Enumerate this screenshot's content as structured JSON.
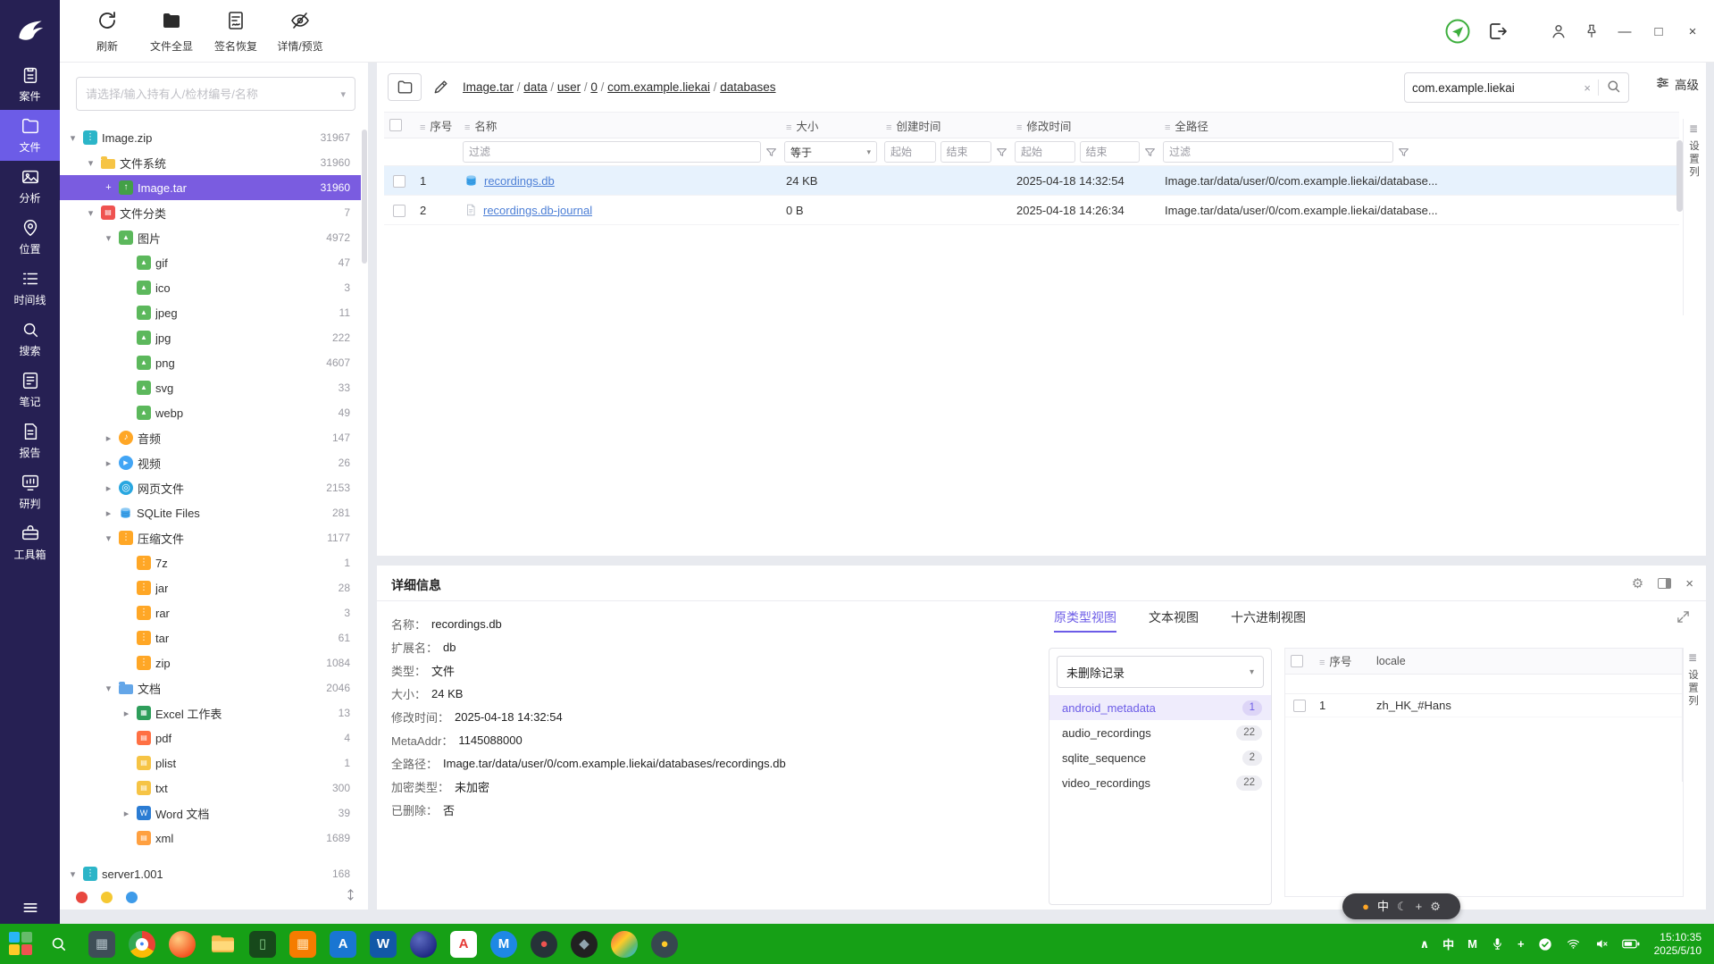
{
  "icons": {
    "minimize": "—",
    "maximize": "□",
    "close": "×",
    "clear": "×",
    "caret_down": "▾",
    "gear": "⚙",
    "menu": "≣"
  },
  "toolbar": {
    "buttons": [
      {
        "name": "refresh",
        "label": "刷新"
      },
      {
        "name": "show-all-files",
        "label": "文件全显"
      },
      {
        "name": "signature-recovery",
        "label": "签名恢复"
      },
      {
        "name": "detail-preview",
        "label": "详情/预览"
      }
    ]
  },
  "sidebar": {
    "items": [
      {
        "name": "case",
        "label": "案件",
        "active": false
      },
      {
        "name": "files",
        "label": "文件",
        "active": true
      },
      {
        "name": "analysis",
        "label": "分析",
        "active": false
      },
      {
        "name": "location",
        "label": "位置",
        "active": false
      },
      {
        "name": "timeline",
        "label": "时间线",
        "active": false
      },
      {
        "name": "search",
        "label": "搜索",
        "active": false
      },
      {
        "name": "notes",
        "label": "笔记",
        "active": false
      },
      {
        "name": "report",
        "label": "报告",
        "active": false
      },
      {
        "name": "judgement",
        "label": "研判",
        "active": false
      },
      {
        "name": "toolbox",
        "label": "工具箱",
        "active": false
      }
    ]
  },
  "tree": {
    "search_placeholder": "请选择/输入持有人/检材编号/名称",
    "nodes": [
      {
        "label": "Image.zip",
        "count": "31967",
        "level": 0,
        "icon": "zip-blue",
        "arrow": "down"
      },
      {
        "label": "文件系统",
        "count": "31960",
        "level": 1,
        "icon": "folder-yellow",
        "arrow": "down"
      },
      {
        "label": "Image.tar",
        "count": "31960",
        "level": 2,
        "icon": "tar-green",
        "arrow": "plus",
        "selected": true
      },
      {
        "label": "文件分类",
        "count": "7",
        "level": 1,
        "icon": "page-red",
        "arrow": "down"
      },
      {
        "label": "图片",
        "count": "4972",
        "level": 2,
        "icon": "image-green",
        "arrow": "down"
      },
      {
        "label": "gif",
        "count": "47",
        "level": 3,
        "icon": "image-green",
        "arrow": "none"
      },
      {
        "label": "ico",
        "count": "3",
        "level": 3,
        "icon": "image-green",
        "arrow": "none"
      },
      {
        "label": "jpeg",
        "count": "11",
        "level": 3,
        "icon": "image-green",
        "arrow": "none"
      },
      {
        "label": "jpg",
        "count": "222",
        "level": 3,
        "icon": "image-green",
        "arrow": "none"
      },
      {
        "label": "png",
        "count": "4607",
        "level": 3,
        "icon": "image-green",
        "arrow": "none"
      },
      {
        "label": "svg",
        "count": "33",
        "level": 3,
        "icon": "image-green",
        "arrow": "none"
      },
      {
        "label": "webp",
        "count": "49",
        "level": 3,
        "icon": "image-green",
        "arrow": "none"
      },
      {
        "label": "音频",
        "count": "147",
        "level": 2,
        "icon": "audio-orange",
        "arrow": "right"
      },
      {
        "label": "视频",
        "count": "26",
        "level": 2,
        "icon": "video-blue",
        "arrow": "right"
      },
      {
        "label": "网页文件",
        "count": "2153",
        "level": 2,
        "icon": "web-blue",
        "arrow": "right"
      },
      {
        "label": "SQLite Files",
        "count": "281",
        "level": 2,
        "icon": "db-blue",
        "arrow": "right"
      },
      {
        "label": "压缩文件",
        "count": "1177",
        "level": 2,
        "icon": "archive-orange",
        "arrow": "down"
      },
      {
        "label": "7z",
        "count": "1",
        "level": 3,
        "icon": "archive-orange",
        "arrow": "none"
      },
      {
        "label": "jar",
        "count": "28",
        "level": 3,
        "icon": "archive-orange",
        "arrow": "none"
      },
      {
        "label": "rar",
        "count": "3",
        "level": 3,
        "icon": "archive-orange",
        "arrow": "none"
      },
      {
        "label": "tar",
        "count": "61",
        "level": 3,
        "icon": "archive-orange",
        "arrow": "none"
      },
      {
        "label": "zip",
        "count": "1084",
        "level": 3,
        "icon": "archive-orange",
        "arrow": "none"
      },
      {
        "label": "文档",
        "count": "2046",
        "level": 2,
        "icon": "folder-blue",
        "arrow": "down"
      },
      {
        "label": "Excel 工作表",
        "count": "13",
        "level": 3,
        "icon": "excel-green",
        "arrow": "right"
      },
      {
        "label": "pdf",
        "count": "4",
        "level": 3,
        "icon": "pdf-orange",
        "arrow": "none"
      },
      {
        "label": "plist",
        "count": "1",
        "level": 3,
        "icon": "page-yellow",
        "arrow": "none"
      },
      {
        "label": "txt",
        "count": "300",
        "level": 3,
        "icon": "page-yellow",
        "arrow": "none"
      },
      {
        "label": "Word 文档",
        "count": "39",
        "level": 3,
        "icon": "word-blue",
        "arrow": "right"
      },
      {
        "label": "xml",
        "count": "1689",
        "level": 3,
        "icon": "page-orange",
        "arrow": "none"
      },
      {
        "label": "server1.001",
        "count": "168",
        "level": 0,
        "icon": "zip-blue",
        "arrow": "down",
        "spacer_before": true
      }
    ],
    "tag_dots": [
      "#e8473f",
      "#f5c832",
      "#3e9be9"
    ]
  },
  "breadcrumb": {
    "segments": [
      "Image.tar",
      "data",
      "user",
      "0",
      "com.example.liekai",
      "databases"
    ]
  },
  "search": {
    "value": "com.example.liekai",
    "advanced_label": "高级"
  },
  "file_table": {
    "columns": [
      "序号",
      "名称",
      "大小",
      "创建时间",
      "修改时间",
      "全路径"
    ],
    "filters": {
      "name_placeholder": "过滤",
      "size_operator": "等于",
      "created_start": "起始",
      "created_end": "结束",
      "modified_start": "起始",
      "modified_end": "结束",
      "path_placeholder": "过滤"
    },
    "rows": [
      {
        "index": "1",
        "icon": "db-blue",
        "name": "recordings.db",
        "size": "24 KB",
        "created": "",
        "modified": "2025-04-18 14:32:54",
        "path": "Image.tar/data/user/0/com.example.liekai/database...",
        "selected": true
      },
      {
        "index": "2",
        "icon": "file-plain",
        "name": "recordings.db-journal",
        "size": "0 B",
        "created": "",
        "modified": "2025-04-18 14:26:34",
        "path": "Image.tar/data/user/0/com.example.liekai/database...",
        "selected": false
      }
    ],
    "column_settings_label": "设置列"
  },
  "detail_panel": {
    "title": "详细信息",
    "fields": [
      {
        "label": "名称：",
        "value": "recordings.db"
      },
      {
        "label": "扩展名：",
        "value": "db"
      },
      {
        "label": "类型：",
        "value": "文件"
      },
      {
        "label": "大小：",
        "value": "24 KB"
      },
      {
        "label": "修改时间：",
        "value": "2025-04-18 14:32:54"
      },
      {
        "label": "MetaAddr：",
        "value": "1145088000"
      },
      {
        "label": "全路径：",
        "value": "Image.tar/data/user/0/com.example.liekai/databases/recordings.db"
      },
      {
        "label": "加密类型：",
        "value": "未加密"
      },
      {
        "label": "已删除：",
        "value": "否"
      }
    ],
    "tabs": [
      {
        "label": "原类型视图",
        "active": true
      },
      {
        "label": "文本视图",
        "active": false
      },
      {
        "label": "十六进制视图",
        "active": false
      }
    ],
    "record_filter": "未删除记录",
    "tables": [
      {
        "name": "android_metadata",
        "count": "1",
        "selected": true
      },
      {
        "name": "audio_recordings",
        "count": "22",
        "selected": false
      },
      {
        "name": "sqlite_sequence",
        "count": "2",
        "selected": false
      },
      {
        "name": "video_recordings",
        "count": "22",
        "selected": false
      }
    ],
    "data_table": {
      "columns": [
        "序号",
        "locale"
      ],
      "rows": [
        {
          "index": "1",
          "locale": "zh_HK_#Hans"
        }
      ],
      "column_settings_label": "设置列"
    }
  },
  "ime_bar": {
    "items": [
      {
        "name": "ime-logo-icon",
        "glyph": "●",
        "color": "#ffa726"
      },
      {
        "name": "ime-chinese-mode-icon",
        "glyph": "中",
        "color": "#ffffff"
      },
      {
        "name": "ime-night-mode-icon",
        "glyph": "☾",
        "color": "#d8d8d8"
      },
      {
        "name": "ime-plus-icon",
        "glyph": "+",
        "color": "#d8d8d8"
      },
      {
        "name": "ime-settings-icon",
        "glyph": "⚙",
        "color": "#d8d8d8"
      }
    ]
  },
  "taskbar": {
    "time": "15:10:35",
    "date": "2025/5/10",
    "apps": [
      {
        "name": "system-monitor-app",
        "shape": "square",
        "bg": "#3e4e57",
        "glyph": "▦",
        "fg": "#b0bec5"
      },
      {
        "name": "chrome-browser",
        "shape": "circle",
        "bg": "conic-gradient(#ea4335 0deg 120deg, #fbbc05 120deg 240deg, #34a853 240deg 360deg)",
        "glyph": "●",
        "fg": "#4285f4",
        "ring": true
      },
      {
        "name": "firefox-browser",
        "shape": "circle",
        "bg": "radial-gradient(circle at 35% 30%, #ffcc80, #f4511e 75%)",
        "glyph": "",
        "fg": ""
      },
      {
        "name": "file-manager",
        "shape": "folder",
        "bg": "",
        "glyph": "",
        "fg": ""
      },
      {
        "name": "android-terminal",
        "shape": "square",
        "bg": "#17491b",
        "glyph": "▯",
        "fg": "#81c784"
      },
      {
        "name": "orange-grid-tool",
        "shape": "square",
        "bg": "#f57c00",
        "glyph": "▦",
        "fg": "#ffe0b2"
      },
      {
        "name": "blue-a-editor",
        "shape": "square",
        "bg": "#1976d2",
        "glyph": "A",
        "fg": "#ffffff"
      },
      {
        "name": "word-processor",
        "shape": "square",
        "bg": "#1258a7",
        "glyph": "W",
        "fg": "#ffffff"
      },
      {
        "name": "thunderbird-mail",
        "shape": "circle",
        "bg": "radial-gradient(circle at 35% 30%, #5c6bc0, #1a237e 80%)",
        "glyph": "",
        "fg": ""
      },
      {
        "name": "red-a-tool",
        "shape": "square",
        "bg": "#ffffff",
        "glyph": "A",
        "fg": "#e53935"
      },
      {
        "name": "m-media-tool",
        "shape": "circle",
        "bg": "#1e88e5",
        "glyph": "M",
        "fg": "#ffffff"
      },
      {
        "name": "screen-recorder",
        "shape": "circle",
        "bg": "#263238",
        "glyph": "●",
        "fg": "#ef5350"
      },
      {
        "name": "dark-utility",
        "shape": "circle",
        "bg": "#212121",
        "glyph": "◆",
        "fg": "#90a4ae"
      },
      {
        "name": "bird-messenger",
        "shape": "circle",
        "bg": "linear-gradient(135deg, #ef5350, #ffca28 40%, #66bb6a 70%, #29b6f6)",
        "glyph": "",
        "fg": ""
      },
      {
        "name": "cherry-tool",
        "shape": "circle",
        "bg": "#37474f",
        "glyph": "●",
        "fg": "#ffca28"
      }
    ],
    "tray": [
      {
        "name": "tray-expand-icon",
        "glyph": "∧"
      },
      {
        "name": "ime-language-indicator",
        "glyph": "中"
      },
      {
        "name": "input-method-icon",
        "glyph": "M"
      },
      {
        "name": "microphone-icon",
        "glyph": ""
      },
      {
        "name": "usb-device-icon",
        "glyph": "+"
      },
      {
        "name": "security-check-icon",
        "glyph": ""
      },
      {
        "name": "wifi-icon",
        "glyph": ""
      },
      {
        "name": "volume-muted-icon",
        "glyph": ""
      },
      {
        "name": "battery-icon",
        "glyph": ""
      }
    ]
  }
}
